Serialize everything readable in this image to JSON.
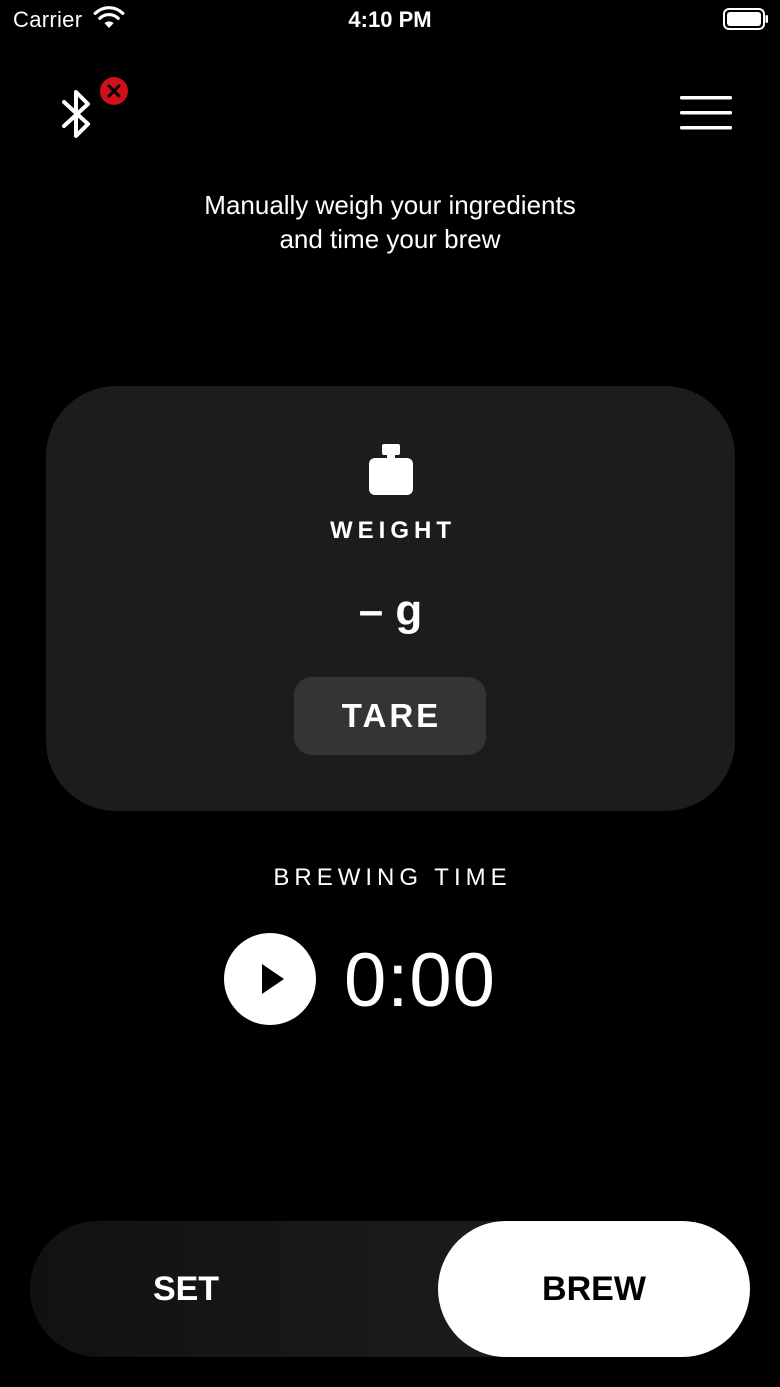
{
  "status_bar": {
    "carrier": "Carrier",
    "time": "4:10 PM",
    "wifi_icon": "wifi-icon",
    "battery_icon": "battery-icon"
  },
  "header": {
    "bluetooth_icon": "bluetooth-icon",
    "bluetooth_status": "disconnected",
    "error_badge_icon": "close-icon",
    "error_color": "#d0101a",
    "menu_icon": "hamburger-menu-icon"
  },
  "subtitle": {
    "line1": "Manually weigh your ingredients",
    "line2": "and time your brew"
  },
  "weight_card": {
    "icon": "scale-weight-icon",
    "label": "WEIGHT",
    "value": "– g",
    "tare_label": "TARE"
  },
  "brewing": {
    "label": "BREWING TIME",
    "play_icon": "play-icon",
    "timer": "0:00"
  },
  "mode_toggle": {
    "set_label": "SET",
    "brew_label": "BREW",
    "selected": "BREW"
  }
}
